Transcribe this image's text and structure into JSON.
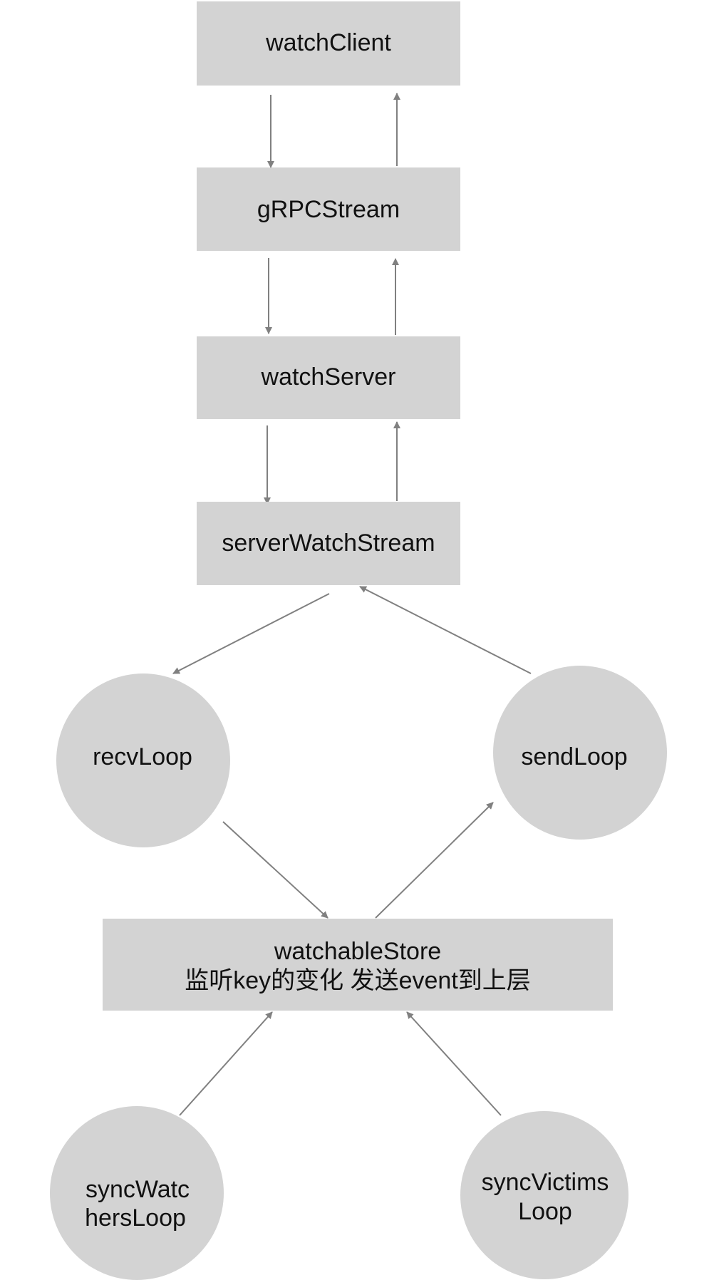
{
  "colors": {
    "node_fill": "#d3d3d3",
    "edge": "#808080",
    "text": "#111111"
  },
  "nodes": {
    "watch_client": {
      "label": "watchClient"
    },
    "grpc_stream": {
      "label": "gRPCStream"
    },
    "watch_server": {
      "label": "watchServer"
    },
    "server_watch_stream": {
      "label": "serverWatchStream"
    },
    "recv_loop": {
      "label": "recvLoop"
    },
    "send_loop": {
      "label": "sendLoop"
    },
    "watchable_store": {
      "label_line1": "watchableStore",
      "label_line2": "监听key的变化 发送event到上层"
    },
    "sync_watchers_loop": {
      "label_line1": "syncWatc",
      "label_line2": "hersLoop"
    },
    "sync_victims_loop": {
      "label_line1": "syncVictims",
      "label_line2": "Loop"
    }
  },
  "edges": [
    {
      "from": "watch_client",
      "to": "grpc_stream"
    },
    {
      "from": "grpc_stream",
      "to": "watch_client"
    },
    {
      "from": "grpc_stream",
      "to": "watch_server"
    },
    {
      "from": "watch_server",
      "to": "grpc_stream"
    },
    {
      "from": "watch_server",
      "to": "server_watch_stream"
    },
    {
      "from": "server_watch_stream",
      "to": "watch_server"
    },
    {
      "from": "server_watch_stream",
      "to": "recv_loop"
    },
    {
      "from": "send_loop",
      "to": "server_watch_stream"
    },
    {
      "from": "recv_loop",
      "to": "watchable_store"
    },
    {
      "from": "watchable_store",
      "to": "send_loop"
    },
    {
      "from": "sync_watchers_loop",
      "to": "watchable_store"
    },
    {
      "from": "sync_victims_loop",
      "to": "watchable_store"
    }
  ]
}
